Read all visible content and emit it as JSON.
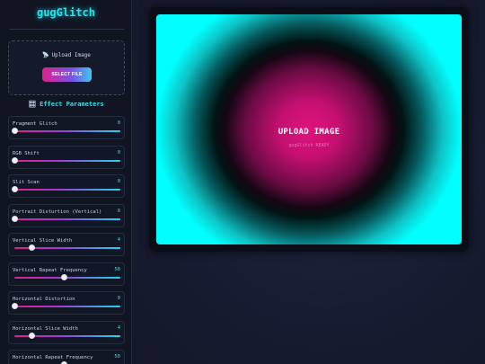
{
  "app": {
    "title": "gugGlitch"
  },
  "upload": {
    "icon": "satellite-dish-icon",
    "label": "Upload Image",
    "button_label": "SELECT FILE"
  },
  "params": {
    "icon": "control-knobs-icon",
    "heading": "Effect Parameters",
    "items": [
      {
        "label": "Fragment Glitch",
        "value": "0",
        "level": 0
      },
      {
        "label": "RGB Shift",
        "value": "0",
        "level": 0
      },
      {
        "label": "Slit Scan",
        "value": "0",
        "level": 0
      },
      {
        "label": "Portrait Disturtion (Vertical)",
        "value": "0",
        "level": 0
      },
      {
        "label": "Vertical Slice Width",
        "value": "4",
        "level": 0.16
      },
      {
        "label": "Vertical Repeat Frequency",
        "value": "50",
        "level": 0.47
      },
      {
        "label": "Horizontal Distortion",
        "value": "0",
        "level": 0
      },
      {
        "label": "Horizontal Slice Width",
        "value": "4",
        "level": 0.16
      },
      {
        "label": "Horizontal Repeat Frequency",
        "value": "50",
        "level": 0.47
      }
    ]
  },
  "canvas": {
    "title": "UPLOAD IMAGE",
    "subtitle": "gugGlitch READY"
  },
  "colors": {
    "accent_cyan": "#22e6ef",
    "accent_pink": "#e01f8a",
    "background": "#15192b"
  }
}
